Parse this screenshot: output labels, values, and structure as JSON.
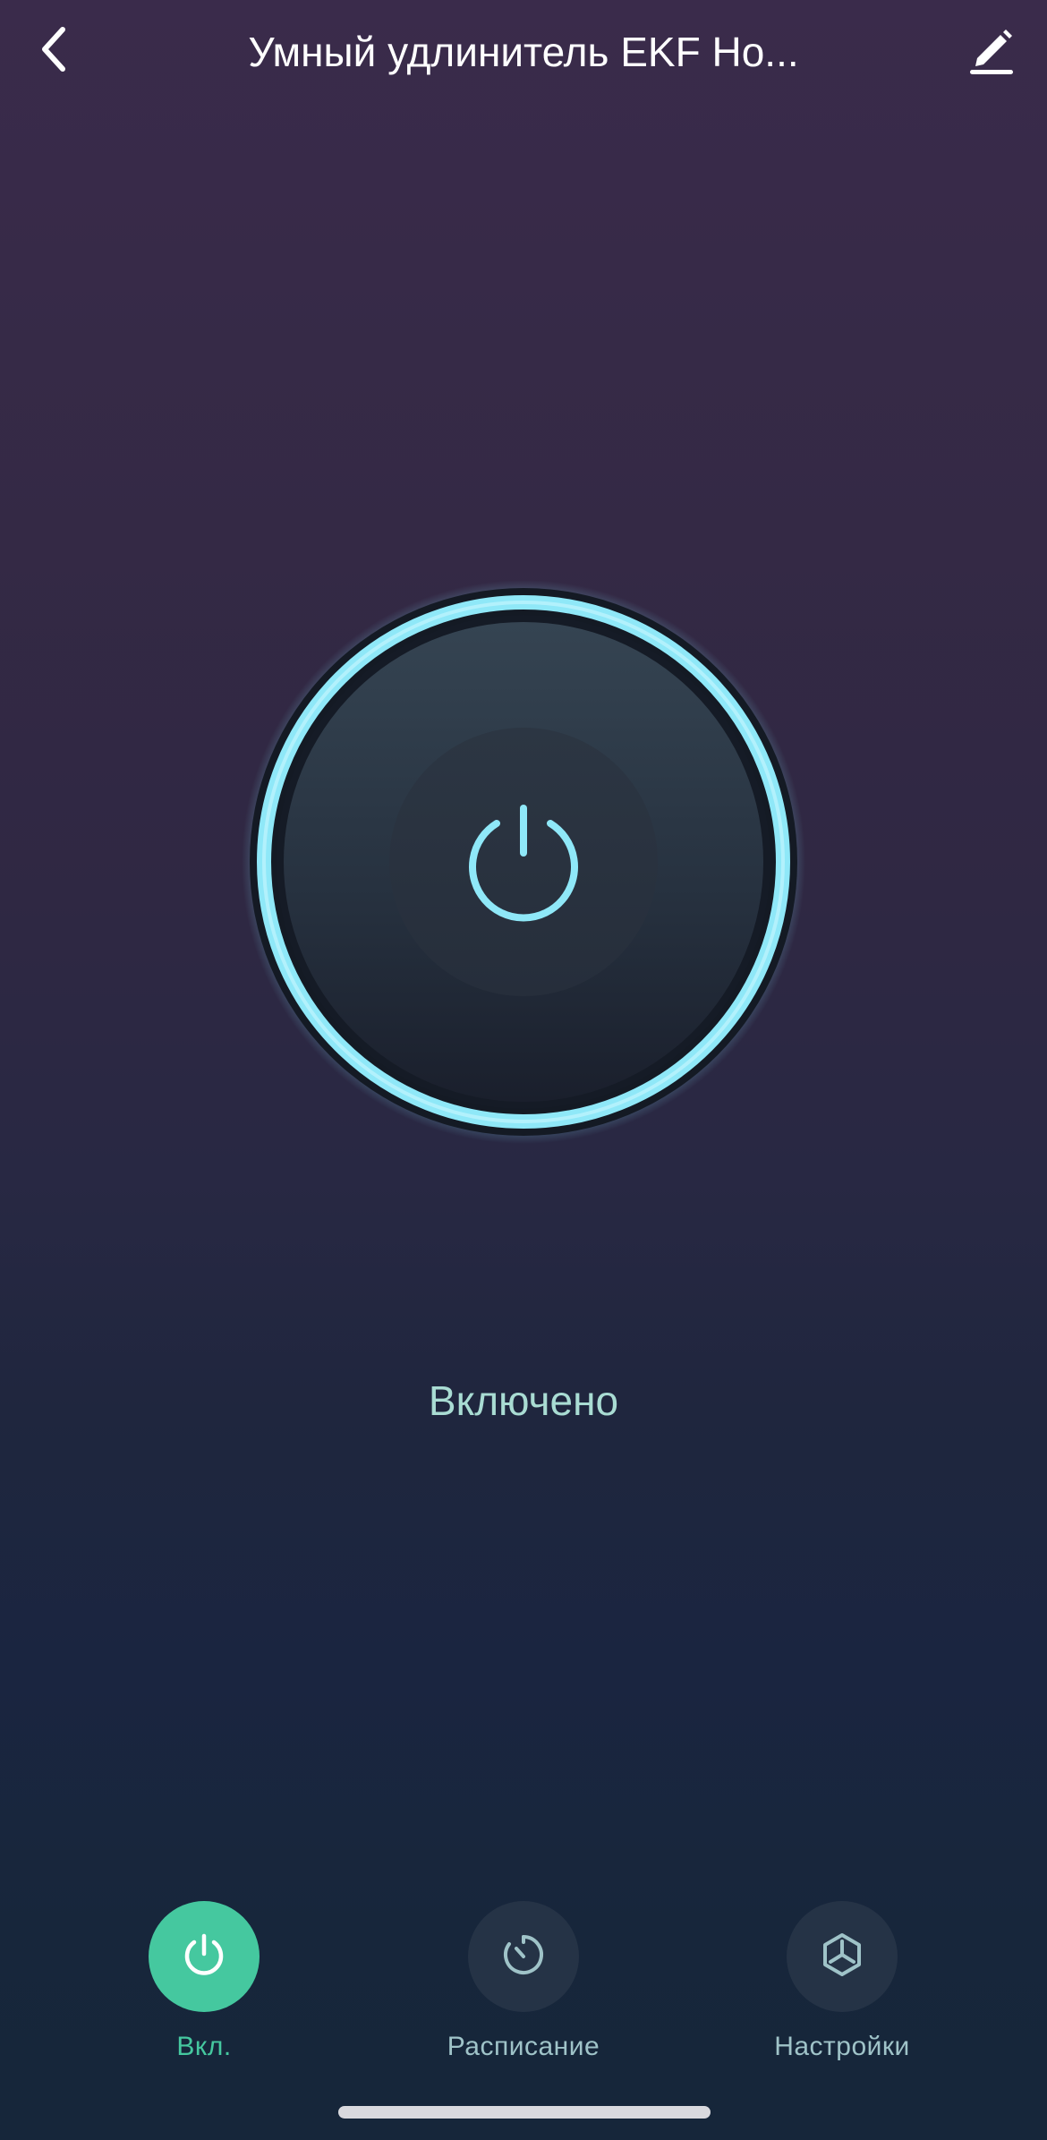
{
  "header": {
    "title": "Умный удлинитель EKF Ho...",
    "back_icon": "chevron-left-icon",
    "edit_icon": "pencil-icon"
  },
  "device": {
    "power_icon": "power-icon",
    "status": "Включено",
    "is_on": true
  },
  "tabs": [
    {
      "label": "Вкл.",
      "icon": "power-icon",
      "active": true
    },
    {
      "label": "Расписание",
      "icon": "timer-icon",
      "active": false
    },
    {
      "label": "Настройки",
      "icon": "cube-icon",
      "active": false
    }
  ],
  "colors": {
    "accent_green": "#45c89f",
    "ring_glow": "#8fe8f8",
    "status_text": "#a9dcd3",
    "tab_label": "#9fc3c8"
  }
}
